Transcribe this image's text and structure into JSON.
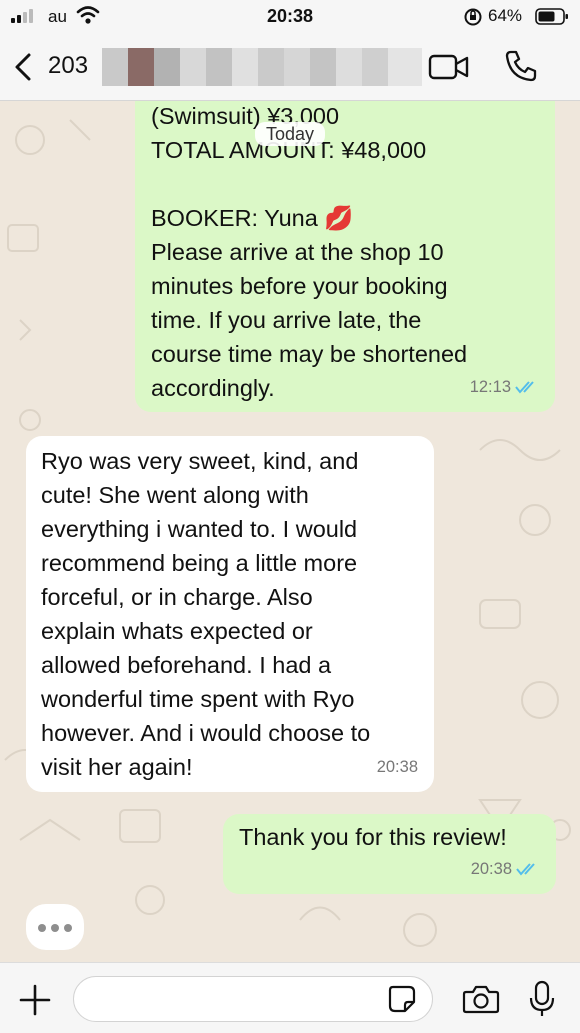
{
  "status_bar": {
    "carrier": "au",
    "time": "20:38",
    "battery": "64%"
  },
  "header": {
    "contact": "203"
  },
  "date_chip": "Today",
  "messages": [
    {
      "direction": "outgoing",
      "text": "(Swimsuit) ¥3,000\nTOTAL AMOUNT: ¥48,000\n\nBOOKER: Yuna 💋\nPlease arrive at the shop 10\nminutes before your booking\ntime. If you arrive late, the\ncourse time may be shortened\naccordingly.",
      "time": "12:13",
      "read": true
    },
    {
      "direction": "incoming",
      "text": "Ryo was very sweet, kind, and\ncute! She went along with\neverything i wanted to. I would\nrecommend being a little more\nforceful, or in charge. Also\nexplain whats expected or\nallowed beforehand. I had a\nwonderful time spent with Ryo\nhowever. And i would choose to\nvisit her again!",
      "time": "20:38"
    },
    {
      "direction": "outgoing",
      "text": "Thank you for this review!",
      "time": "20:38",
      "read": true
    }
  ],
  "colors": {
    "outgoing_bubble": "#dbf8c7",
    "incoming_bubble": "#ffffff",
    "read_ticks": "#53bdeb",
    "chat_background": "#efe7dc"
  },
  "icons": [
    "back-icon",
    "video-call-icon",
    "voice-call-icon",
    "plus-icon",
    "sticker-icon",
    "camera-icon",
    "microphone-icon",
    "wifi-icon",
    "signal-icon",
    "battery-icon",
    "orientation-lock-icon"
  ]
}
